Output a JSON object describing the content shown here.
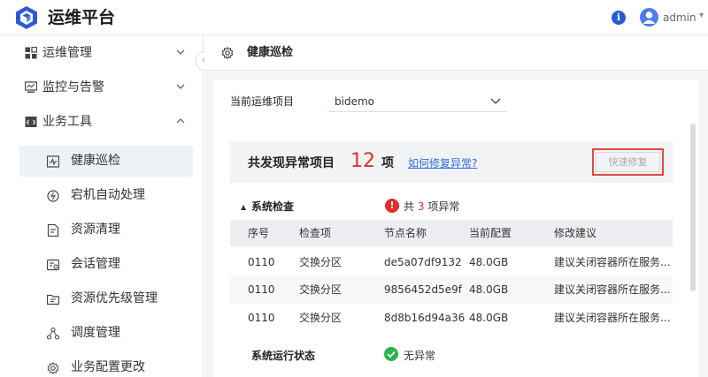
{
  "header": {
    "app_title": "运维平台",
    "user_name": "admin",
    "logo_icon": "cube-logo-icon",
    "info_icon": "info-icon"
  },
  "sidebar": {
    "groups": [
      {
        "label": "运维管理",
        "icon": "grid-icon",
        "expanded": false
      },
      {
        "label": "监控与告警",
        "icon": "monitor-icon",
        "expanded": false
      },
      {
        "label": "业务工具",
        "icon": "code-window-icon",
        "expanded": true
      }
    ],
    "sub_items": [
      {
        "label": "健康巡检",
        "icon": "pulse-icon",
        "active": true
      },
      {
        "label": "宕机自动处理",
        "icon": "power-icon",
        "active": false
      },
      {
        "label": "资源清理",
        "icon": "clean-icon",
        "active": false
      },
      {
        "label": "会话管理",
        "icon": "session-icon",
        "active": false
      },
      {
        "label": "资源优先级管理",
        "icon": "priority-icon",
        "active": false
      },
      {
        "label": "调度管理",
        "icon": "schedule-icon",
        "active": false
      },
      {
        "label": "业务配置更改",
        "icon": "config-icon",
        "active": false
      }
    ]
  },
  "breadcrumb": {
    "title": "健康巡检"
  },
  "project": {
    "label": "当前运维项目",
    "selected": "bidemo"
  },
  "summary": {
    "prefix": "共发现异常项目",
    "count": "12",
    "suffix": "项",
    "help_link": "如何修复异常?",
    "quick_fix_label": "快速修复"
  },
  "system_check": {
    "title": "系统检查",
    "error_prefix": "共",
    "error_count": "3",
    "error_suffix": "项异常",
    "columns": [
      "序号",
      "检查项",
      "节点名称",
      "当前配置",
      "修改建议"
    ],
    "rows": [
      [
        "0110",
        "交换分区",
        "de5a07df9132",
        "48.0GB",
        "建议关闭容器所在服务..."
      ],
      [
        "0110",
        "交换分区",
        "9856452d5e9f",
        "48.0GB",
        "建议关闭容器所在服务..."
      ],
      [
        "0110",
        "交换分区",
        "8d8b16d94a36",
        "48.0GB",
        "建议关闭容器所在服务..."
      ]
    ]
  },
  "runtime_status": {
    "label": "系统运行状态",
    "status": "无异常"
  },
  "colors": {
    "accent": "#2f6ce5",
    "error": "#e0302a",
    "success": "#2bb24c",
    "active_bg": "#eef1f5"
  }
}
